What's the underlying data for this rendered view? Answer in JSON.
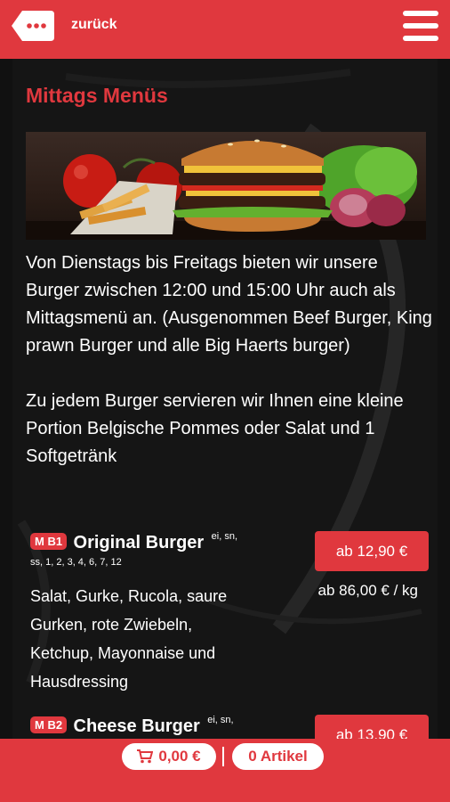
{
  "header": {
    "back_label": "zurück"
  },
  "page": {
    "title": "Mittags Menüs"
  },
  "intro": {
    "paragraph1": "Von Dienstags bis Freitags bieten wir unsere Burger zwischen 12:00 und 15:00 Uhr auch als Mittagsmenü an. (Ausgenommen Beef Burger, King prawn Burger und alle Big Haerts burger)",
    "paragraph2": "Zu jedem Burger servieren wir Ihnen eine kleine Portion Belgische Pommes oder Salat und 1 Softgetränk"
  },
  "items": [
    {
      "code": "M B1",
      "name": "Original Burger",
      "allergens_inline": "ei, sn,",
      "allergens_line": "ss, 1, 2, 3, 4, 6, 7, 12",
      "description": "Salat, Gurke, Rucola, saure Gurken, rote Zwiebeln, Ketchup, Mayonnaise und Hausdressing",
      "price": "ab 12,90 €",
      "unit_price": "ab 86,00 € / kg"
    },
    {
      "code": "M B2",
      "name": "Cheese Burger",
      "allergens_inline": "ei, sn,",
      "price": "ab 13,90 €"
    }
  ],
  "cart": {
    "total": "0,00 €",
    "count": "0 Artikel"
  },
  "colors": {
    "accent": "#e0383e",
    "background": "#111111"
  }
}
